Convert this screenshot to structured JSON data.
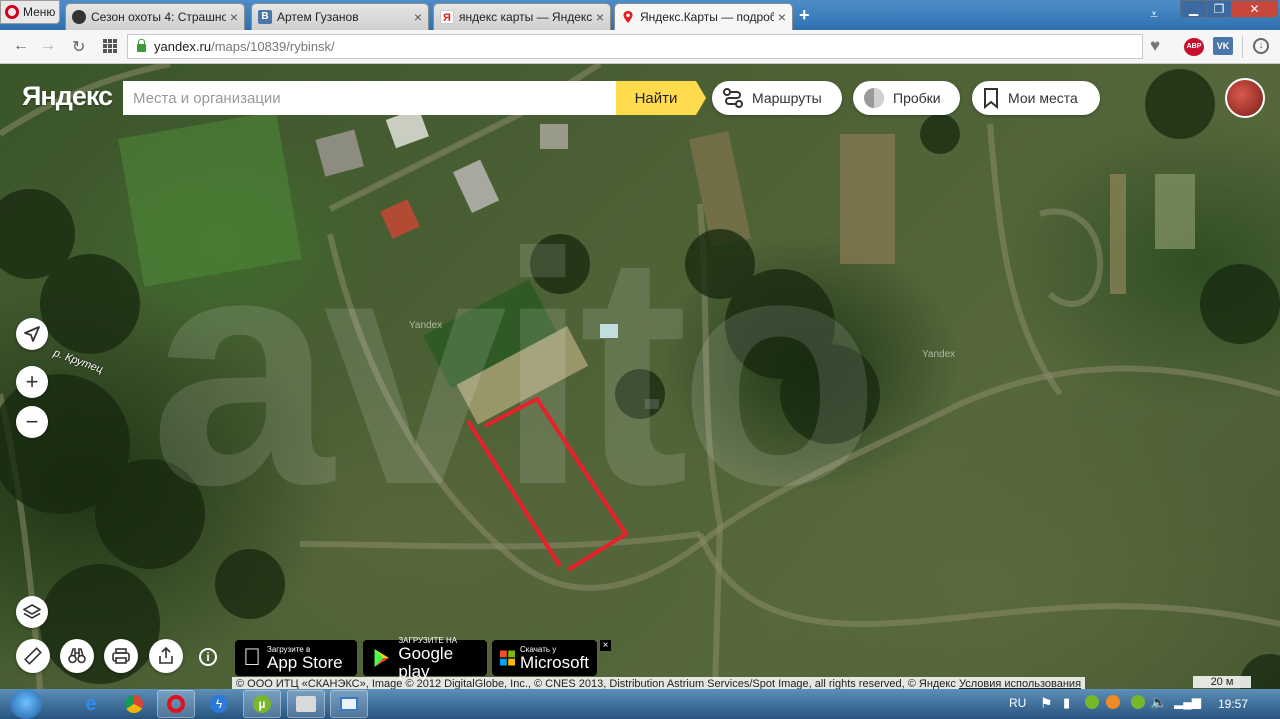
{
  "browser": {
    "menu_label": "Меню",
    "tabs": [
      {
        "title": "Сезон охоты 4: Страшно",
        "icon": "hunter-favicon",
        "color": "#333333"
      },
      {
        "title": "Артем Гузанов",
        "icon": "vk-favicon",
        "color": "#4a76a8"
      },
      {
        "title": "яндекс карты — Яндекс:",
        "icon": "yandex-favicon",
        "color": "#e51c1c"
      },
      {
        "title": "Яндекс.Карты — подроб",
        "icon": "yandex-maps-pin-favicon",
        "color": "#e51c1c"
      }
    ],
    "url_host": "yandex.ru",
    "url_path": "/maps/10839/rybinsk/",
    "ext_abp": "ABP",
    "ext_vk": "VK"
  },
  "map": {
    "logo": "Яндекс",
    "search_placeholder": "Места и организации",
    "search_button": "Найти",
    "routes_label": "Маршруты",
    "traffic_label": "Пробки",
    "my_places_label": "Мои места",
    "river_label": "р. Крутец",
    "watermark": "Yandex",
    "overlay_watermark": "avito",
    "highlight_color": "#e8202a",
    "appstore_small": "Загрузите в",
    "appstore_big": "App Store",
    "googleplay_small": "ЗАГРУЗИТЕ НА",
    "googleplay_big": "Google play",
    "microsoft_small": "Скачать у",
    "microsoft_big": "Microsoft",
    "copyright": "© ООО ИТЦ «СКАНЭКС», Image © 2012 DigitalGlobe, Inc., © CNES 2013, Distribution Astrium Services/Spot Image, all rights reserved, © Яндекс",
    "terms_link": "Условия использования",
    "scale": "20 м"
  },
  "taskbar": {
    "lang": "RU",
    "time": "19:57"
  }
}
